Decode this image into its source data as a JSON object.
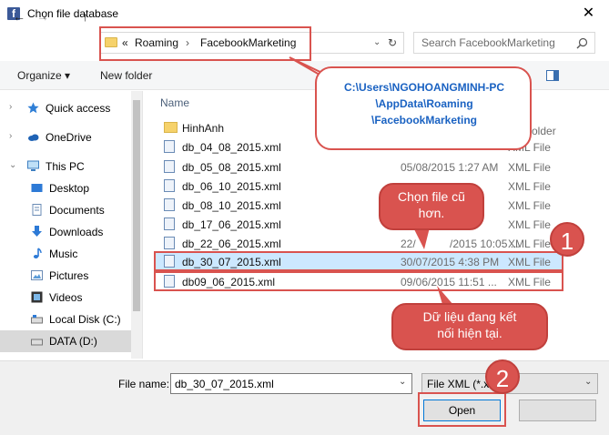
{
  "window": {
    "title": "Chọn file database",
    "close_glyph": "✕"
  },
  "nav": {
    "back_glyph": "←",
    "forward_glyph": "→",
    "dropdown_glyph": "⌄",
    "up_glyph": "↑",
    "crumb_overflow": "«",
    "crumbs": [
      "Roaming",
      "FacebookMarketing"
    ],
    "crumb_sep": "›",
    "refresh_glyph": "↻",
    "search_placeholder": "Search FacebookMarketing"
  },
  "toolbar": {
    "organize": "Organize ▾",
    "new_folder": "New folder"
  },
  "sidebar": {
    "items": [
      {
        "label": "Quick access",
        "icon": "star-icon"
      },
      {
        "label": "OneDrive",
        "icon": "cloud-icon"
      },
      {
        "label": "This PC",
        "icon": "computer-icon"
      },
      {
        "label": "Desktop",
        "icon": "desktop-icon"
      },
      {
        "label": "Documents",
        "icon": "documents-icon"
      },
      {
        "label": "Downloads",
        "icon": "download-icon"
      },
      {
        "label": "Music",
        "icon": "music-icon"
      },
      {
        "label": "Pictures",
        "icon": "pictures-icon"
      },
      {
        "label": "Videos",
        "icon": "videos-icon"
      },
      {
        "label": "Local Disk (C:)",
        "icon": "drive-icon"
      },
      {
        "label": "DATA (D:)",
        "icon": "drive-icon"
      }
    ]
  },
  "file_list": {
    "col_name": "Name",
    "col_type_partial": "older",
    "rows": [
      {
        "name": "HinhAnh",
        "date": "",
        "type": ""
      },
      {
        "name": "db_04_08_2015.xml",
        "date": "",
        "type": "XML File"
      },
      {
        "name": "db_05_08_2015.xml",
        "date": "05/08/2015 1:27 AM",
        "type": "XML File"
      },
      {
        "name": "db_06_10_2015.xml",
        "date": "",
        "type": "XML File"
      },
      {
        "name": "db_08_10_2015.xml",
        "date": "",
        "type": "XML File"
      },
      {
        "name": "db_17_06_2015.xml",
        "date": "",
        "type": "XML File"
      },
      {
        "name": "db_22_06_2015.xml",
        "date": "22/",
        "date_tail": "/2015 10:05 ...",
        "type": "XML File"
      },
      {
        "name": "db_30_07_2015.xml",
        "date": "30/07/2015 4:38 PM",
        "type": "XML File"
      },
      {
        "name": "db09_06_2015.xml",
        "date": "09/06/2015 11:51 ...",
        "type": "XML File"
      }
    ]
  },
  "bottom": {
    "file_name_label": "File name:",
    "file_name_value": "db_30_07_2015.xml",
    "file_type_value": "File XML (*.x",
    "open_label": "Open",
    "cancel_label": ""
  },
  "annotations": {
    "path_callout": [
      "C:\\Users\\NGOHOANGMINH-PC",
      "\\AppData\\Roaming",
      "\\FacebookMarketing"
    ],
    "older_callout": [
      "Chọn file cũ",
      "hơn."
    ],
    "current_callout": [
      "Dữ liệu đang kết",
      "nối hiện tại."
    ],
    "badge_1": "1",
    "badge_2": "2"
  },
  "colors": {
    "accent_red": "#d9534f",
    "selection": "#cce8ff",
    "path_text": "#1a62c2"
  }
}
